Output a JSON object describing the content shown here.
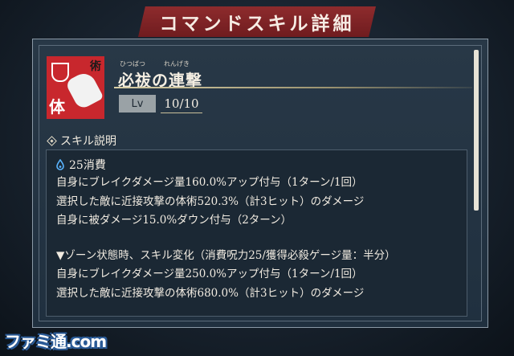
{
  "header": {
    "title": "コマンドスキル詳細"
  },
  "skill": {
    "icon_name": "strike-fist-icon",
    "icon_kanji_top": "術",
    "icon_kanji_bottom": "体",
    "ruby_1": "ひつばつ",
    "ruby_2": "れんげき",
    "name": "必祓の連撃",
    "level_label": "Lv",
    "level_value": "10/10"
  },
  "description": {
    "section_label": "スキル説明",
    "cost": "25消費",
    "cost_icon": "spirit-drop-icon",
    "lines": [
      "自身にブレイクダメージ量160.0%アップ付与（1ターン/1回）",
      "選択した敵に近接攻撃の体術520.3%（計3ヒット）のダメージ",
      "自身に被ダメージ15.0%ダウン付与（2ターン）"
    ],
    "zone_lines": [
      "▼ゾーン状態時、スキル変化（消費呪力25/獲得必殺ゲージ量：半分）",
      "自身にブレイクダメージ量250.0%アップ付与（1ターン/1回）",
      "選択した敵に近接攻撃の体術680.0%（計3ヒット）のダメージ"
    ]
  },
  "watermark": "ファミ通.com",
  "colors": {
    "banner": "#8e2b2d",
    "panel": "#283847",
    "icon_bg": "#c8272d",
    "level_badge": "#9aa2a6"
  }
}
